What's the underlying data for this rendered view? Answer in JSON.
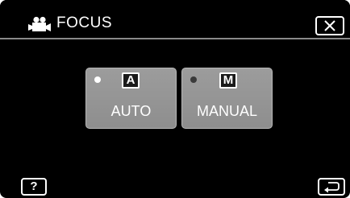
{
  "header": {
    "title": "FOCUS",
    "mode_icon": "movie-camera-icon"
  },
  "controls": {
    "close_icon": "close-icon",
    "help_label": "?",
    "back_icon": "return-arrow-icon"
  },
  "options": [
    {
      "letter": "A",
      "label": "AUTO",
      "selected": true
    },
    {
      "letter": "M",
      "label": "MANUAL",
      "selected": false
    }
  ],
  "colors": {
    "background": "#000000",
    "button_face": "#969696",
    "text": "#ffffff"
  }
}
